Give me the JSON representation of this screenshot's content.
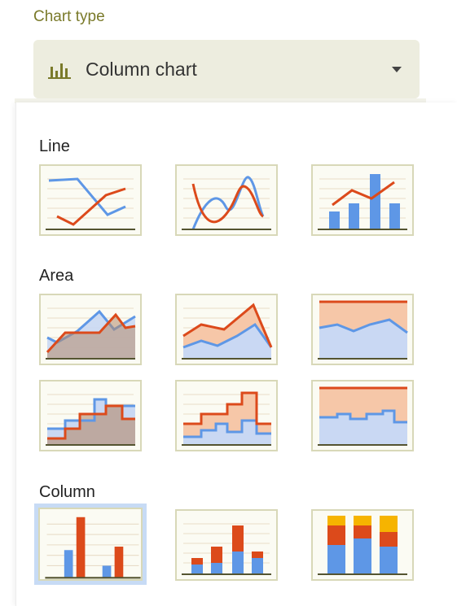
{
  "header": {
    "section_title": "Chart type",
    "selected_type": "Column chart",
    "selected_icon": "column-chart-icon"
  },
  "colors": {
    "blue": "#5e97e6",
    "red": "#dc4a1b",
    "yellow": "#f6b400",
    "baseline": "#545430",
    "gridline": "#e8dcc7",
    "selection": "#c7dbf5"
  },
  "groups": [
    {
      "title": "Line",
      "options": [
        "line-chart",
        "smooth-line-chart",
        "combo-chart"
      ]
    },
    {
      "title": "Area",
      "options": [
        "area-chart",
        "stacked-area-chart",
        "100-percent-stacked-area-chart",
        "stepped-area-chart",
        "stacked-stepped-area-chart",
        "100-percent-stacked-stepped-area-chart"
      ]
    },
    {
      "title": "Column",
      "options": [
        "column-chart",
        "stacked-column-chart",
        "100-percent-stacked-column-chart"
      ],
      "selected": "column-chart"
    }
  ]
}
